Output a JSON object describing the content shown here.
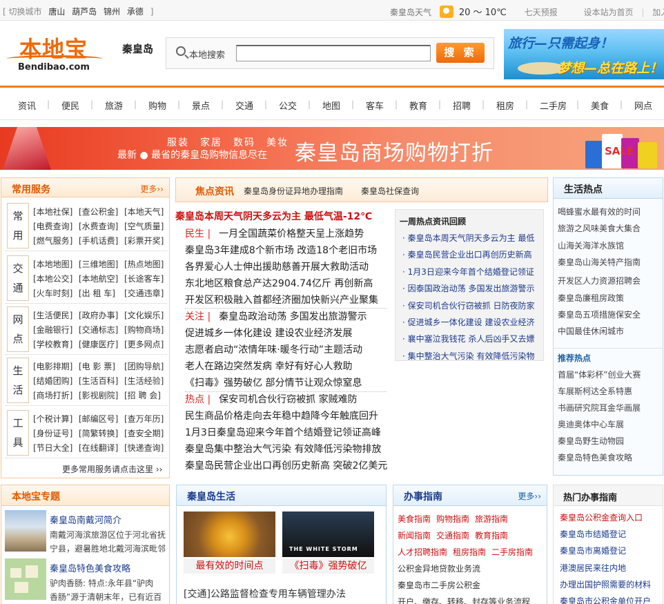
{
  "topbar": {
    "cities_prefix": "[ 切换城市",
    "cities": [
      "唐山",
      "葫芦岛",
      "锦州",
      "承德"
    ],
    "cities_suffix": "]",
    "weather_label": "秦皇岛天气",
    "temperature": "20 ～ 10℃",
    "forecast_link": "七天预报",
    "set_home": "设本站为首页",
    "divider": "|",
    "bookmark": "加入收藏"
  },
  "header": {
    "logo_cn": "本地宝",
    "logo_en": "Bendibao.com",
    "city": "秦皇岛",
    "search_label": "本地搜索",
    "search_value": "",
    "search_button": "搜 索",
    "ad_line1": "旅行—只需起身！",
    "ad_line2": "梦想—总在路上！"
  },
  "nav": [
    "资讯",
    "便民",
    "旅游",
    "购物",
    "景点",
    "交通",
    "公交",
    "地图",
    "客车",
    "教育",
    "招聘",
    "租房",
    "二手房",
    "美食",
    "网点"
  ],
  "banner": {
    "line1": "服装　家居　数码　美妆",
    "line2": "最新 ● 最省的秦皇岛购物信息尽在",
    "big": "秦皇岛商场购物打折",
    "sale": "SALE"
  },
  "services": {
    "title": "常用服务",
    "more": "更多››",
    "groups": [
      {
        "cat": [
          "常",
          "用"
        ],
        "links": [
          "[本地社保]",
          "[查公积金]",
          "[本地天气]",
          "[电费查询]",
          "[水费查询]",
          "[空气质量]",
          "[燃气服务]",
          "[手机话费]",
          "[彩票开奖]"
        ]
      },
      {
        "cat": [
          "交",
          "通"
        ],
        "links": [
          "[本地地图]",
          "[三维地图]",
          "[热点地图]",
          "[本地公交]",
          "[本地航空]",
          "[长途客车]",
          "[火车时刻]",
          "[出 租 车]",
          "[交通违章]"
        ]
      },
      {
        "cat": [
          "网",
          "点"
        ],
        "links": [
          "[生活便民]",
          "[政府办事]",
          "[文化娱乐]",
          "[金融银行]",
          "[交通标志]",
          "[购物商场]",
          "[学校教育]",
          "[健康医疗]",
          "[更多网点]"
        ]
      },
      {
        "cat": [
          "生",
          "活"
        ],
        "links": [
          "[电影排期]",
          "[电 影 票]",
          "[团购导航]",
          "[结婚团购]",
          "[生活百科]",
          "[生活经验]",
          "[商场打折]",
          "[影视剧院]",
          "[招 聘 会]"
        ]
      },
      {
        "cat": [
          "工",
          "具"
        ],
        "links": [
          "[个税计算]",
          "[邮编区号]",
          "[查万年历]",
          "[身份证号]",
          "[简繁转换]",
          "[查安全期]",
          "[节日大全]",
          "[在线翻译]",
          "[快递查询]"
        ]
      }
    ],
    "footer": "更多常用服务请点击这里  ››"
  },
  "focus": {
    "title": "焦点资讯",
    "links": [
      "秦皇岛身份证异地办理指南",
      "秦皇岛社保查询"
    ],
    "headline": "秦皇岛本周天气阴天多云为主 最低气温-12℃",
    "news": [
      {
        "tag": "民生 |",
        "text": "一月全国蔬菜价格整天呈上涨趋势"
      },
      {
        "tag": "",
        "text": "秦皇岛3年建成8个新市场 改造18个老旧市场"
      },
      {
        "tag": "",
        "text": "各界爱心人士伸出援助慈善开展大救助活动"
      },
      {
        "tag": "",
        "text": "东北地区粮食总产达2904.74亿斤 再创新高"
      },
      {
        "tag": "",
        "text": "开发区积极融入首都经济圈加快新兴产业聚集"
      },
      {
        "tag": "关注 |",
        "text": "秦皇岛政治动荡 多国发出旅游警示"
      },
      {
        "tag": "",
        "text": "促进城乡一体化建设 建设农业经济发展"
      },
      {
        "tag": "",
        "text": "志愿者启动“浓情年味·暖冬行动”主题活动"
      },
      {
        "tag": "",
        "text": "老人在路边突然发病 幸好有好心人救助"
      },
      {
        "tag": "",
        "text": "《扫毒》强势破亿 部分情节让观众惊窒息"
      },
      {
        "tag": "热点 |",
        "text": "保安司机合伙行窃被抓 家贼难防"
      },
      {
        "tag": "",
        "text": "民生商品价格走向去年稳中趋降今年触底回升"
      },
      {
        "tag": "",
        "text": "1月3日秦皇岛迎来今年首个结婚登记领证高峰"
      },
      {
        "tag": "",
        "text": "秦皇岛集中整治大气污染 有效降低污染物排放"
      },
      {
        "tag": "",
        "text": "秦皇岛民营企业出口再创历史新高 突破2亿美元"
      }
    ],
    "weekly_title": "一周热点资讯回顾",
    "weekly": [
      "秦皇岛本周天气阴天多云为主 最低",
      "秦皇岛民营企业出口再创历史新高",
      "1月3日迎来今年首个结婚登记领证",
      "因泰国政治动荡 多国发出旅游警示",
      "保安司机合伙行窃被抓 日防夜防家",
      "促进城乡一体化建设 建设农业经济",
      "襄中塞泣我钱花 杀人后凶手又去嫖",
      "集中整治大气污染 有效降低污染物"
    ]
  },
  "life_hot": {
    "title": "生活热点",
    "items": [
      "喝蜂蜜水最有效的时间",
      "旅游之风味美食大集合",
      "山海关海洋水族馆",
      "秦皇岛山海关特产指南",
      "开发区人力资源招聘会",
      "秦皇岛廉租房政策",
      "秦皇岛五项措施保安全",
      "中国最佳休闲城市"
    ],
    "rec_title": "推荐热点",
    "rec": [
      "首届“体彩杯”创业大赛",
      "车展斯柯达全系特惠",
      "书画研究院耳金华画展",
      "奥迪奥体中心车展",
      "秦皇岛野生动物园",
      "秦皇岛特色美食攻略"
    ]
  },
  "topics": {
    "title": "本地宝专题",
    "items": [
      {
        "title": "秦皇岛南戴河简介",
        "desc1": "南戴河海滨旅游区位于河北省抚",
        "desc2": "宁县，避暑胜地北戴河海滨毗邻"
      },
      {
        "title": "秦皇岛特色美食攻略",
        "desc1": "驴肉香肠: 特点:永年县“驴肉",
        "desc2": "香肠”源于清朝末年，已有近百"
      }
    ]
  },
  "qhd_life": {
    "title": "秦皇岛生活",
    "cap1": "最有效的时间点",
    "cap2": "《扫毒》强势破亿",
    "poster_text": "THE WHITE STORM",
    "line": "[交通]公路监督检查专用车辆管理办法"
  },
  "guide": {
    "title": "办事指南",
    "more": "更多››",
    "rows": [
      [
        "美食指南",
        "购物指南",
        "旅游指南"
      ],
      [
        "新闻指南",
        "交通指南",
        "教育指南"
      ],
      [
        "人才招聘指南",
        "租房指南",
        "二手房指南"
      ]
    ],
    "plain": [
      "公积金异地贷款业务流",
      "秦皇岛市二手房公积金",
      "开户、缴存、转移、封存等业务流程"
    ]
  },
  "hot_guide": {
    "title": "热门办事指南",
    "items": [
      "秦皇岛公积金查询入口",
      "秦皇岛市结婚登记",
      "秦皇岛市离婚登记",
      "港澳居民来往内地",
      "办理出国护照需要的材料",
      "秦皇岛市公积金单位开户"
    ]
  },
  "colors": {
    "accent": "#f07b1a",
    "link_red": "#cc1010",
    "link_blue": "#1a5fa6"
  }
}
